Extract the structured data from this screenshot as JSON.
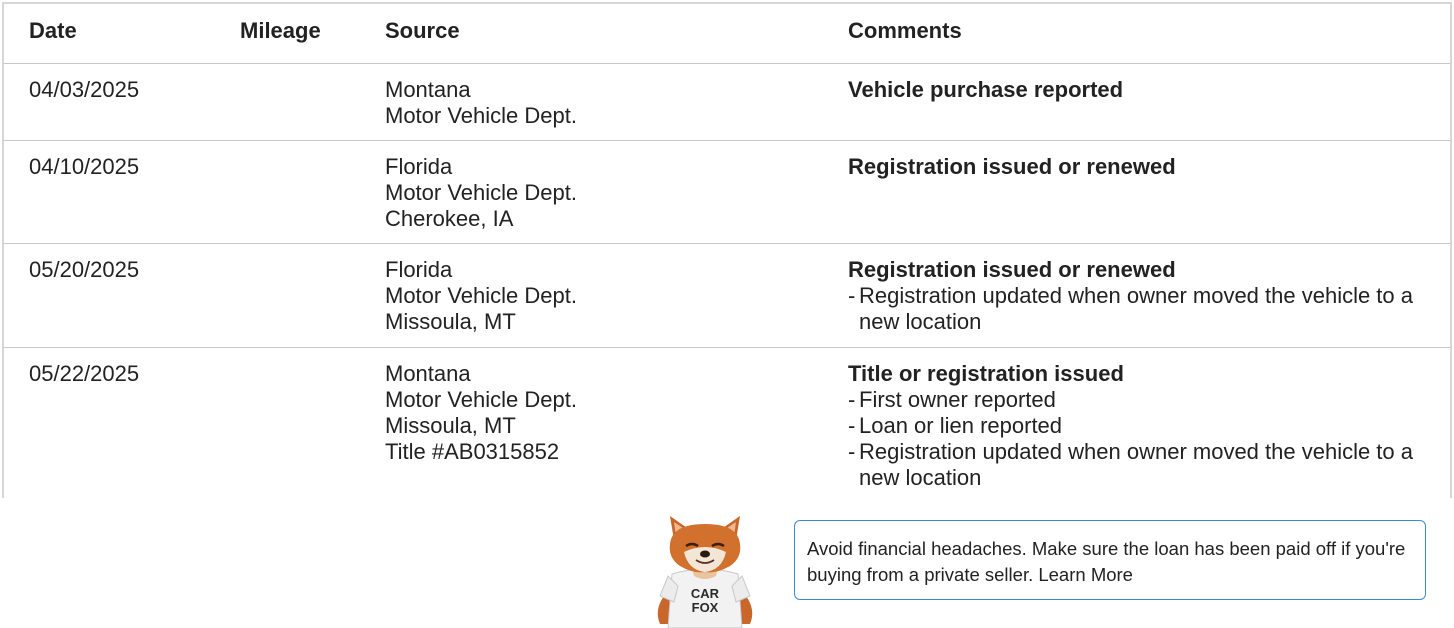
{
  "table": {
    "headers": {
      "date": "Date",
      "mileage": "Mileage",
      "source": "Source",
      "comments": "Comments"
    },
    "rows": [
      {
        "date": "04/03/2025",
        "mileage": "",
        "source": [
          "Montana",
          "Motor Vehicle Dept."
        ],
        "comment_title": "Vehicle purchase reported",
        "comment_items": []
      },
      {
        "date": "04/10/2025",
        "mileage": "",
        "source": [
          "Florida",
          "Motor Vehicle Dept.",
          "Cherokee, IA"
        ],
        "comment_title": "Registration issued or renewed",
        "comment_items": []
      },
      {
        "date": "05/20/2025",
        "mileage": "",
        "source": [
          "Florida",
          "Motor Vehicle Dept.",
          "Missoula, MT"
        ],
        "comment_title": "Registration issued or renewed",
        "comment_items": [
          "Registration updated when owner moved the vehicle to a new location"
        ]
      },
      {
        "date": "05/22/2025",
        "mileage": "",
        "source": [
          "Montana",
          "Motor Vehicle Dept.",
          "Missoula, MT",
          "Title #AB0315852"
        ],
        "comment_title": "Title or registration issued",
        "comment_items": [
          "First owner reported",
          "Loan or lien reported",
          "Registration updated when owner moved the vehicle to a new location"
        ]
      }
    ]
  },
  "promo": {
    "mascot_shirt_line1": "CAR",
    "mascot_shirt_line2": "FOX",
    "tip_text": "Avoid financial headaches. Make sure the loan has been paid off if you're buying from a private seller.",
    "tip_link": "Learn More"
  },
  "colors": {
    "border": "#d6d6d6",
    "tip_border": "#3c8ad6",
    "text": "#222222"
  }
}
